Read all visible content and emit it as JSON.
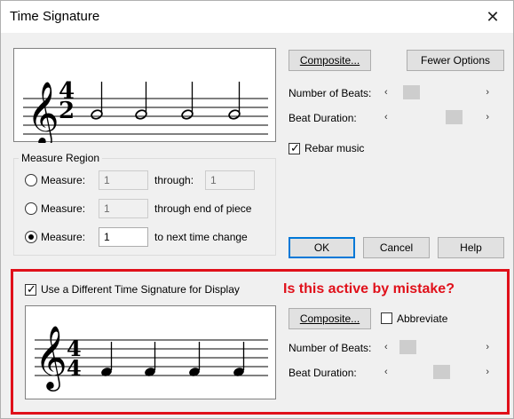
{
  "window": {
    "title": "Time Signature"
  },
  "top": {
    "composite_label": "Composite...",
    "fewer_options_label": "Fewer Options",
    "beats_label": "Number of Beats:",
    "duration_label": "Beat Duration:",
    "beats_value_fraction": 0.1,
    "duration_value_fraction": 0.75,
    "rebar_label": "Rebar music",
    "rebar_checked": true,
    "time_sig_top": "4",
    "time_sig_bottom": "2"
  },
  "measure_region": {
    "title": "Measure Region",
    "row1": {
      "label": "Measure:",
      "from": "1",
      "through_label": "through:",
      "through": "1"
    },
    "row2": {
      "label": "Measure:",
      "from": "1",
      "suffix": "through end of piece"
    },
    "row3": {
      "label": "Measure:",
      "from": "1",
      "suffix": "to next time change",
      "selected": true
    }
  },
  "buttons": {
    "ok": "OK",
    "cancel": "Cancel",
    "help": "Help"
  },
  "display": {
    "checkbox_label": "Use a Different Time Signature for Display",
    "checked": true,
    "composite_label": "Composite...",
    "abbreviate_label": "Abbreviate",
    "abbreviate_checked": false,
    "beats_label": "Number of Beats:",
    "duration_label": "Beat Duration:",
    "beats_value_fraction": 0.1,
    "duration_value_fraction": 0.6,
    "time_sig_top": "4",
    "time_sig_bottom": "4"
  },
  "annotation": {
    "text": "Is this active by mistake?"
  },
  "colors": {
    "annotation": "#e0101a",
    "accent": "#0078d7"
  },
  "icons": {
    "close": "close-icon",
    "clef": "treble-clef-icon"
  }
}
